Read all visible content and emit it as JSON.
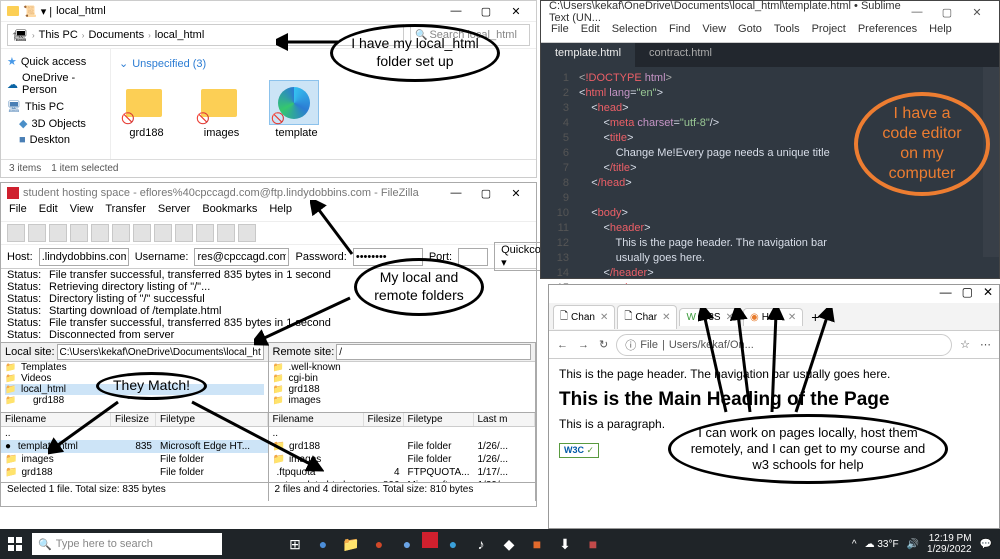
{
  "explorer": {
    "title": "local_html",
    "breadcrumb": [
      "This PC",
      "Documents",
      "local_html"
    ],
    "search_ph": "Search local_html",
    "sidebar": {
      "quick": "Quick access",
      "onedrive": "OneDrive - Person",
      "thispc": "This PC",
      "objects": "3D Objects",
      "desktop": "Deskton"
    },
    "group": "Unspecified (3)",
    "files": [
      {
        "name": "grd188"
      },
      {
        "name": "images"
      },
      {
        "name": "template"
      }
    ],
    "status1": "3 items",
    "status2": "1 item selected"
  },
  "filezilla": {
    "title": "student hosting space - eflores%40cpccagd.com@ftp.lindydobbins.com - FileZilla",
    "menu": [
      "File",
      "Edit",
      "View",
      "Transfer",
      "Server",
      "Bookmarks",
      "Help"
    ],
    "host_l": "Host:",
    "host_v": ".lindydobbins.com",
    "user_l": "Username:",
    "user_v": "res@cpccagd.com",
    "pass_l": "Password:",
    "pass_v": "••••••••",
    "port_l": "Port:",
    "btn": "Quickconnect",
    "log": [
      "File transfer successful, transferred 835 bytes in 1 second",
      "Retrieving directory listing of \"/\"...",
      "Directory listing of \"/\" successful",
      "Starting download of /template.html",
      "File transfer successful, transferred 835 bytes in 1 second",
      "Disconnected from server"
    ],
    "status_label": "Status:",
    "local_l": "Local site:",
    "local_v": "C:\\Users\\kekaf\\OneDrive\\Documents\\local_html\\",
    "remote_l": "Remote site:",
    "remote_v": "/",
    "local_tree": [
      "Templates",
      "Videos",
      "local_html",
      "grd188"
    ],
    "remote_tree": [
      ".well-known",
      "cgi-bin",
      "grd188",
      "images"
    ],
    "cols": {
      "name": "Filename",
      "size": "Filesize",
      "type": "Filetype",
      "mod": "Last m"
    },
    "local_files": [
      {
        "name": "..",
        "size": "",
        "type": "",
        "mod": ""
      },
      {
        "name": "template.html",
        "size": "835",
        "type": "Microsoft Edge HT...",
        "mod": ""
      },
      {
        "name": "images",
        "size": "",
        "type": "File folder",
        "mod": ""
      },
      {
        "name": "grd188",
        "size": "",
        "type": "File folder",
        "mod": ""
      }
    ],
    "remote_files": [
      {
        "name": "..",
        "size": "",
        "type": "",
        "mod": ""
      },
      {
        "name": "grd188",
        "size": "",
        "type": "File folder",
        "mod": "1/26/..."
      },
      {
        "name": "images",
        "size": "",
        "type": "File folder",
        "mod": "1/26/..."
      },
      {
        "name": ".ftpquota",
        "size": "4",
        "type": "FTPQUOTA...",
        "mod": "1/17/..."
      },
      {
        "name": "template.html",
        "size": "806",
        "type": "Microsoft ...",
        "mod": "1/29/..."
      }
    ],
    "stat_local": "Selected 1 file. Total size: 835 bytes",
    "stat_remote": "2 files and 4 directories. Total size: 810 bytes"
  },
  "sublime": {
    "title": "C:\\Users\\kekaf\\OneDrive\\Documents\\local_html\\template.html • Sublime Text (UN...",
    "menu": [
      "File",
      "Edit",
      "Selection",
      "Find",
      "View",
      "Goto",
      "Tools",
      "Project",
      "Preferences",
      "Help"
    ],
    "tabs": [
      "template.html",
      "contract.html"
    ],
    "lines": {
      "l1": "!DOCTYPE",
      "l1b": "html",
      "l2": "html",
      "l2a": "lang",
      "l2v": "\"en\"",
      "l3": "head",
      "l4": "meta",
      "l4a": "charset",
      "l4v": "\"utf-8\"",
      "l5": "title",
      "l6": "Change Me!Every page needs a unique title",
      "l7": "/title",
      "l8": "/head",
      "l10": "body",
      "l11": "header",
      "l12": "This is the page header. The navigation bar",
      "l13": "usually goes here.",
      "l14": "/header",
      "l15": "main"
    }
  },
  "browser": {
    "tabs": [
      {
        "l": "Chan"
      },
      {
        "l": "Char"
      },
      {
        "l": "W3S"
      },
      {
        "l": "Hom"
      }
    ],
    "url_prefix": "File",
    "url": "Users/kekaf/On...",
    "hdr": "This is the page header. The navigation bar usually goes here.",
    "h1": "This is the Main Heading of the Page",
    "p": "This is a paragraph.",
    "w3c": "W3C VALIDATED"
  },
  "taskbar": {
    "search_ph": "Type here to search",
    "temp": "33°F",
    "time": "12:19 PM",
    "date": "1/29/2022"
  },
  "annotations": {
    "a1": "I have my local_html folder set up",
    "a2": "I have a code editor on my computer",
    "a3": "My local and remote folders",
    "a4": "They Match!",
    "a5": "I can work on pages locally, host them remotely, and I can get to my course and w3 schools for help"
  }
}
